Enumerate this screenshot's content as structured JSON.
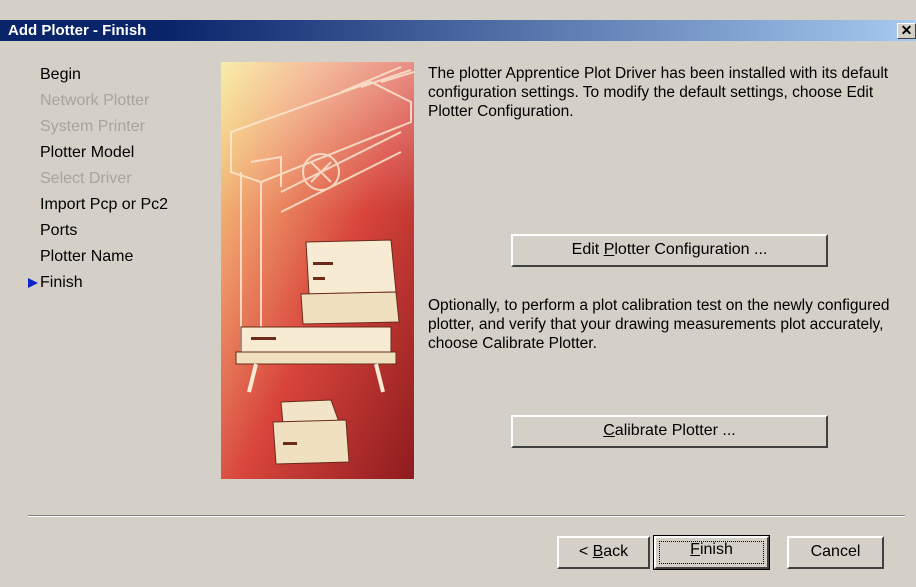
{
  "window": {
    "title": "Add Plotter - Finish",
    "close_label": "✕"
  },
  "steps": [
    {
      "label": "Begin",
      "state": "enabled"
    },
    {
      "label": "Network Plotter",
      "state": "disabled"
    },
    {
      "label": "System Printer",
      "state": "disabled"
    },
    {
      "label": "Plotter Model",
      "state": "enabled"
    },
    {
      "label": "Select Driver",
      "state": "disabled"
    },
    {
      "label": "Import Pcp or Pc2",
      "state": "enabled"
    },
    {
      "label": "Ports",
      "state": "enabled"
    },
    {
      "label": "Plotter Name",
      "state": "enabled"
    },
    {
      "label": "Finish",
      "state": "current"
    }
  ],
  "content": {
    "intro": "The plotter Apprentice Plot Driver has been installed with its default configuration settings.  To modify the default settings, choose Edit Plotter Configuration.",
    "edit_button_pre": "Edit ",
    "edit_button_key": "P",
    "edit_button_post": "lotter Configuration ...",
    "calibrate_text": "Optionally, to perform a plot calibration test on the newly configured plotter, and verify that your drawing measurements plot accurately, choose Calibrate Plotter.",
    "calibrate_button_key": "C",
    "calibrate_button_post": "alibrate Plotter ..."
  },
  "footer": {
    "back_pre": "< ",
    "back_key": "B",
    "back_post": "ack",
    "finish_key": "F",
    "finish_post": "inish",
    "cancel_label": "Cancel"
  },
  "colors": {
    "titlebar_start": "#0a246a",
    "titlebar_end": "#a6caf0",
    "current_arrow": "#0a24c8",
    "disabled_text": "#a8a49c"
  }
}
